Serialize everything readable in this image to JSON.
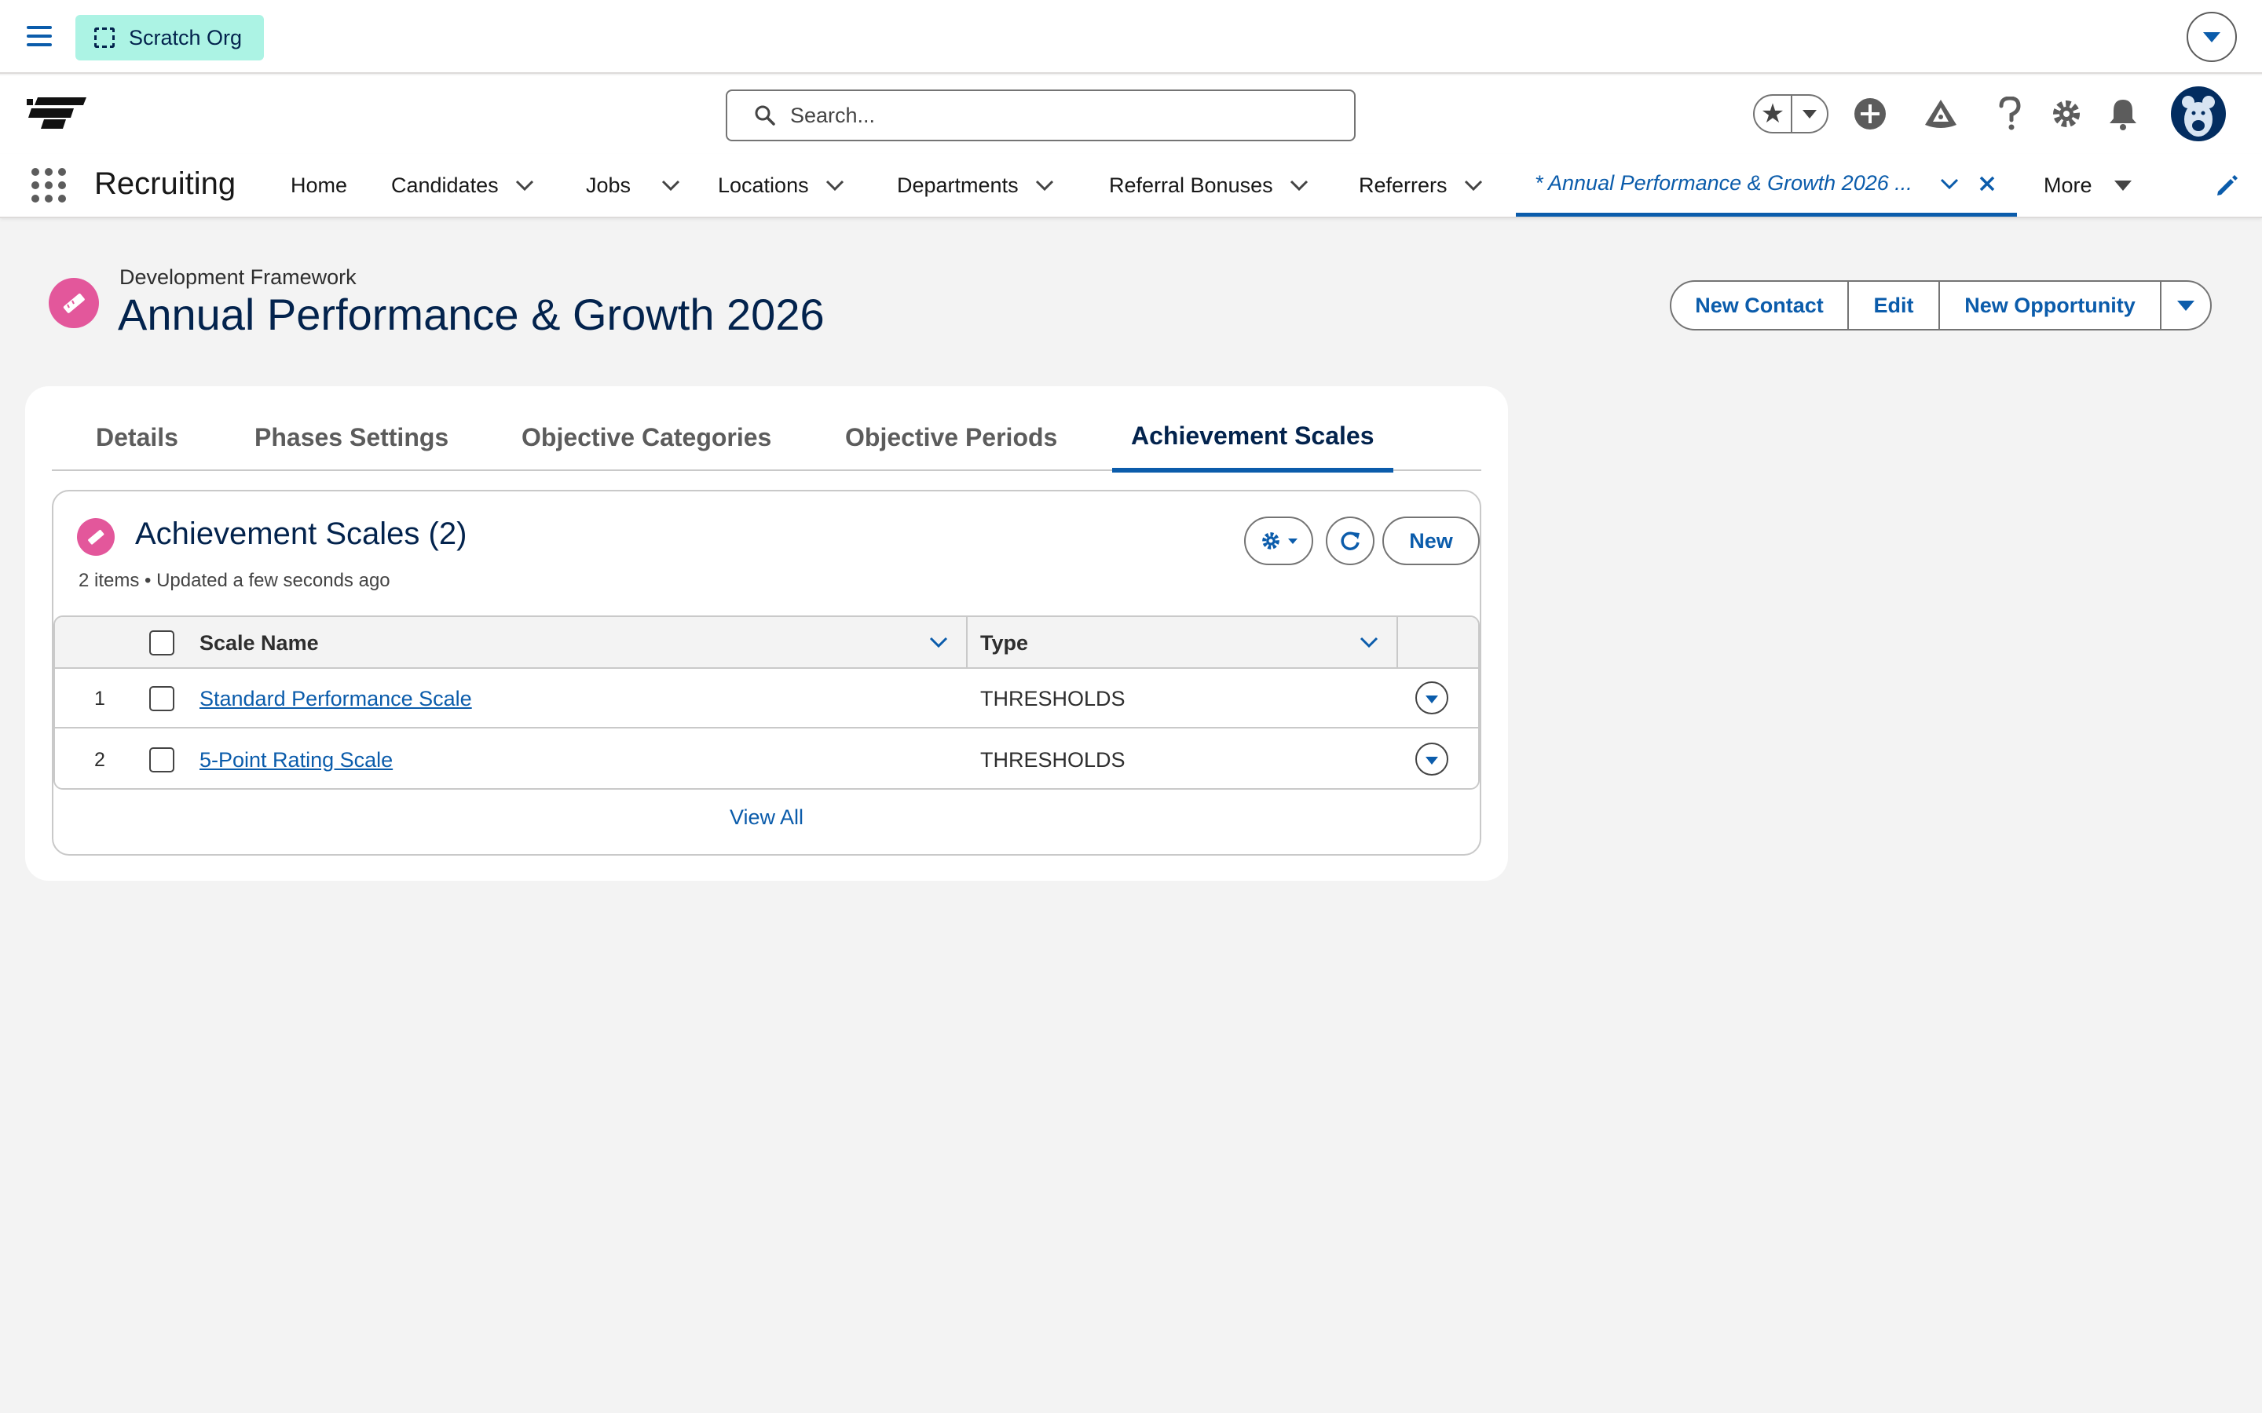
{
  "org_bar": {
    "scratch_label": "Scratch Org"
  },
  "header": {
    "search_placeholder": "Search..."
  },
  "nav": {
    "app_name": "Recruiting",
    "items": [
      {
        "label": "Home"
      },
      {
        "label": "Candidates"
      },
      {
        "label": "Jobs"
      },
      {
        "label": "Locations"
      },
      {
        "label": "Departments"
      },
      {
        "label": "Referral Bonuses"
      },
      {
        "label": "Referrers"
      },
      {
        "label": "* Annual Performance & Growth 2026 ..."
      }
    ],
    "more_label": "More"
  },
  "record": {
    "object_type": "Development Framework",
    "title": "Annual Performance & Growth 2026",
    "actions": {
      "new_contact": "New Contact",
      "edit": "Edit",
      "new_opportunity": "New Opportunity"
    }
  },
  "tabs": [
    {
      "label": "Details"
    },
    {
      "label": "Phases Settings"
    },
    {
      "label": "Objective Categories"
    },
    {
      "label": "Objective Periods"
    },
    {
      "label": "Achievement Scales"
    }
  ],
  "related_list": {
    "title": "Achievement Scales (2)",
    "subtitle": "2 items • Updated a few seconds ago",
    "new_label": "New",
    "columns": {
      "name": "Scale Name",
      "type": "Type"
    },
    "rows": [
      {
        "num": "1",
        "name": "Standard Performance Scale",
        "type": "THRESHOLDS"
      },
      {
        "num": "2",
        "name": "5-Point Rating Scale",
        "type": "THRESHOLDS"
      }
    ],
    "view_all": "View All"
  },
  "colors": {
    "brand_blue": "#0b5cab",
    "navy_text": "#03234d",
    "record_icon_pink": "#e3579b",
    "scratch_teal": "#acf3e4"
  }
}
